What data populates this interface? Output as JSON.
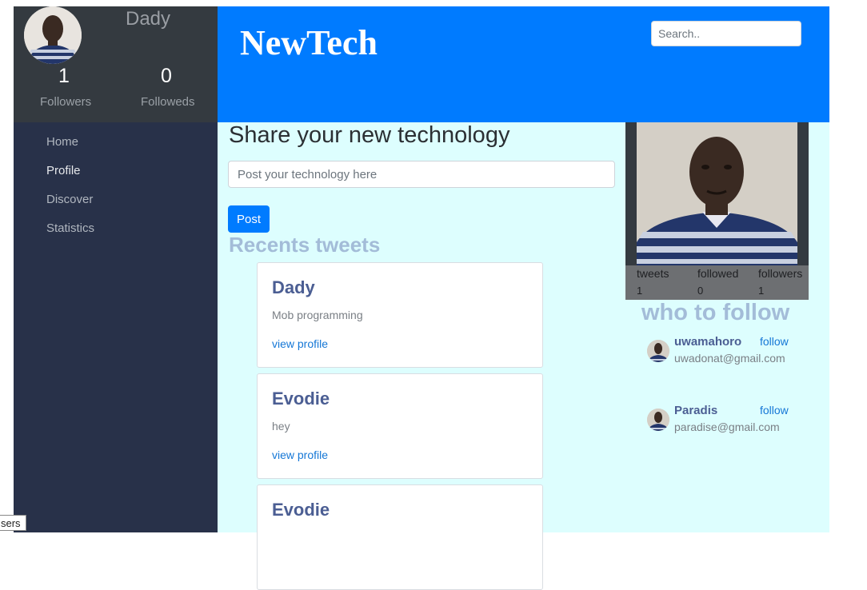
{
  "sidebar": {
    "profile": {
      "name": "Dady",
      "followers_count": "1",
      "followers_label": "Followers",
      "followeds_count": "0",
      "followeds_label": "Followeds"
    },
    "nav": [
      {
        "label": "Home"
      },
      {
        "label": "Profile"
      },
      {
        "label": "Discover"
      },
      {
        "label": "Statistics"
      }
    ],
    "active_item": "Profile"
  },
  "header": {
    "brand": "NewTech",
    "search_placeholder": "Search.."
  },
  "main": {
    "share_title": "Share your new technology",
    "post_placeholder": "Post your technology here",
    "post_button": "Post",
    "recents_title": "Recents tweets",
    "tweets": [
      {
        "author": "Dady",
        "text": "Mob programming",
        "link": "view profile"
      },
      {
        "author": "Evodie",
        "text": "hey",
        "link": "view profile"
      },
      {
        "author": "Evodie",
        "text": "",
        "link": ""
      }
    ]
  },
  "profile_card": {
    "stats": [
      {
        "label": "tweets",
        "value": "1"
      },
      {
        "label": "followed",
        "value": "0"
      },
      {
        "label": "followers",
        "value": "1"
      }
    ]
  },
  "who_to_follow": {
    "title": "who to follow",
    "users": [
      {
        "name": "uwamahoro",
        "email": "uwadonat@gmail.com",
        "action": "follow"
      },
      {
        "name": "Paradis",
        "email": "paradise@gmail.com",
        "action": "follow"
      }
    ]
  },
  "tooltip": {
    "text": "sers"
  },
  "colors": {
    "header_bg": "#007bff",
    "sidebar_bg": "#283149",
    "main_bg": "#ddfefe",
    "accent_heading": "#a3bcd8",
    "author_color": "#4b5e93"
  }
}
